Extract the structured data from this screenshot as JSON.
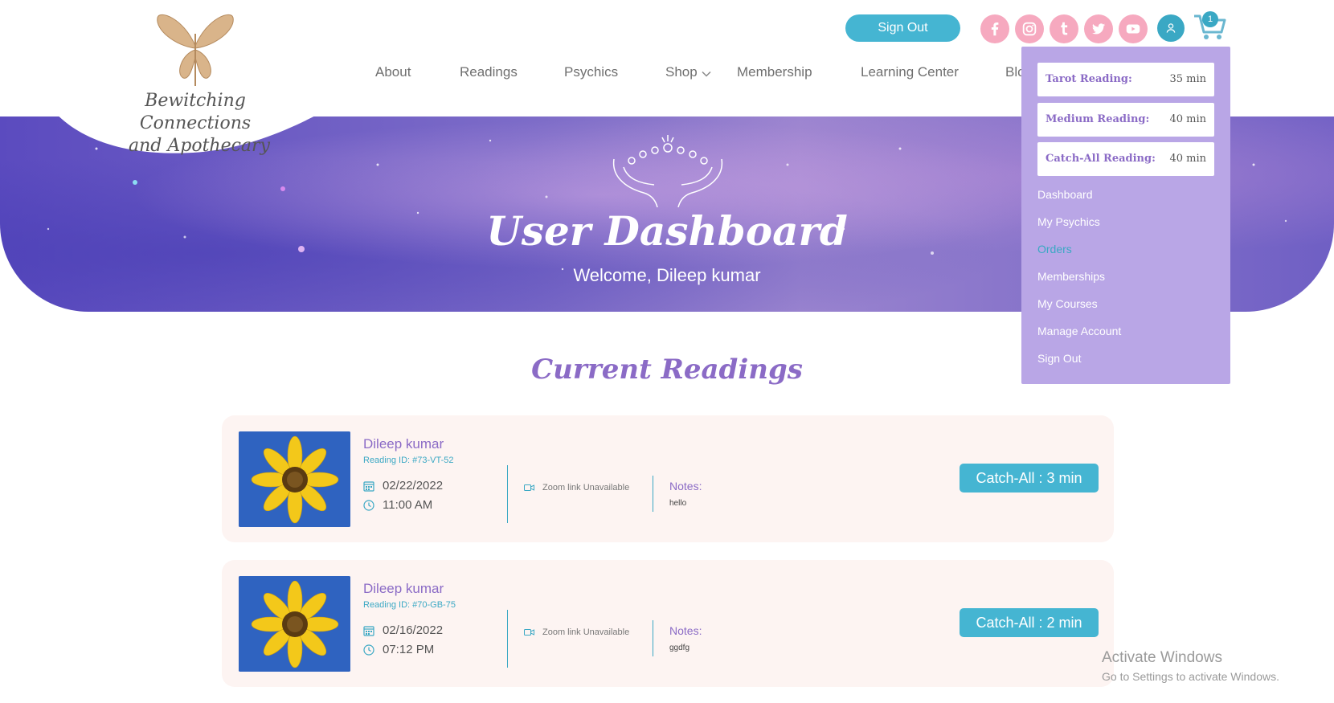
{
  "header": {
    "logo": {
      "line1": "Bewitching Connections",
      "line2": "and Apothecary"
    },
    "sign_out_label": "Sign Out",
    "social_icons": [
      "facebook-icon",
      "instagram-icon",
      "tumblr-icon",
      "twitter-icon",
      "youtube-icon"
    ],
    "cart_count": "1",
    "nav": [
      "About",
      "Readings",
      "Psychics",
      "Shop",
      "Membership",
      "Learning Center",
      "Blo"
    ]
  },
  "hero": {
    "title": "User Dashboard",
    "welcome": "Welcome, Dileep kumar"
  },
  "section": {
    "title": "Current Readings"
  },
  "readings": [
    {
      "name": "Dileep kumar",
      "reading_id": "Reading ID: #73-VT-52",
      "date": "02/22/2022",
      "time": "11:00 AM",
      "zoom": "Zoom link Unavailable",
      "notes_label": "Notes:",
      "notes": "hello",
      "type": "Catch-All : 3 min"
    },
    {
      "name": "Dileep kumar",
      "reading_id": "Reading ID: #70-GB-75",
      "date": "02/16/2022",
      "time": "07:12 PM",
      "zoom": "Zoom link Unavailable",
      "notes_label": "Notes:",
      "notes": "ggdfg",
      "type": "Catch-All : 2 min"
    }
  ],
  "dropdown": {
    "readings": [
      {
        "name": "Tarot Reading:",
        "time": "35 min"
      },
      {
        "name": "Medium Reading:",
        "time": "40 min"
      },
      {
        "name": "Catch-All Reading:",
        "time": "40 min"
      }
    ],
    "links": [
      "Dashboard",
      "My Psychics",
      "Orders",
      "Memberships",
      "My Courses",
      "Manage Account",
      "Sign Out"
    ],
    "active_link": "Orders"
  },
  "watermark": {
    "line1": "Activate Windows",
    "line2": "Go to Settings to activate Windows."
  },
  "colors": {
    "accent_blue": "#45b5d2",
    "purple": "#8b6bc6",
    "menu_bg": "#b9a6e6",
    "social_pink": "#f6a9bf"
  }
}
